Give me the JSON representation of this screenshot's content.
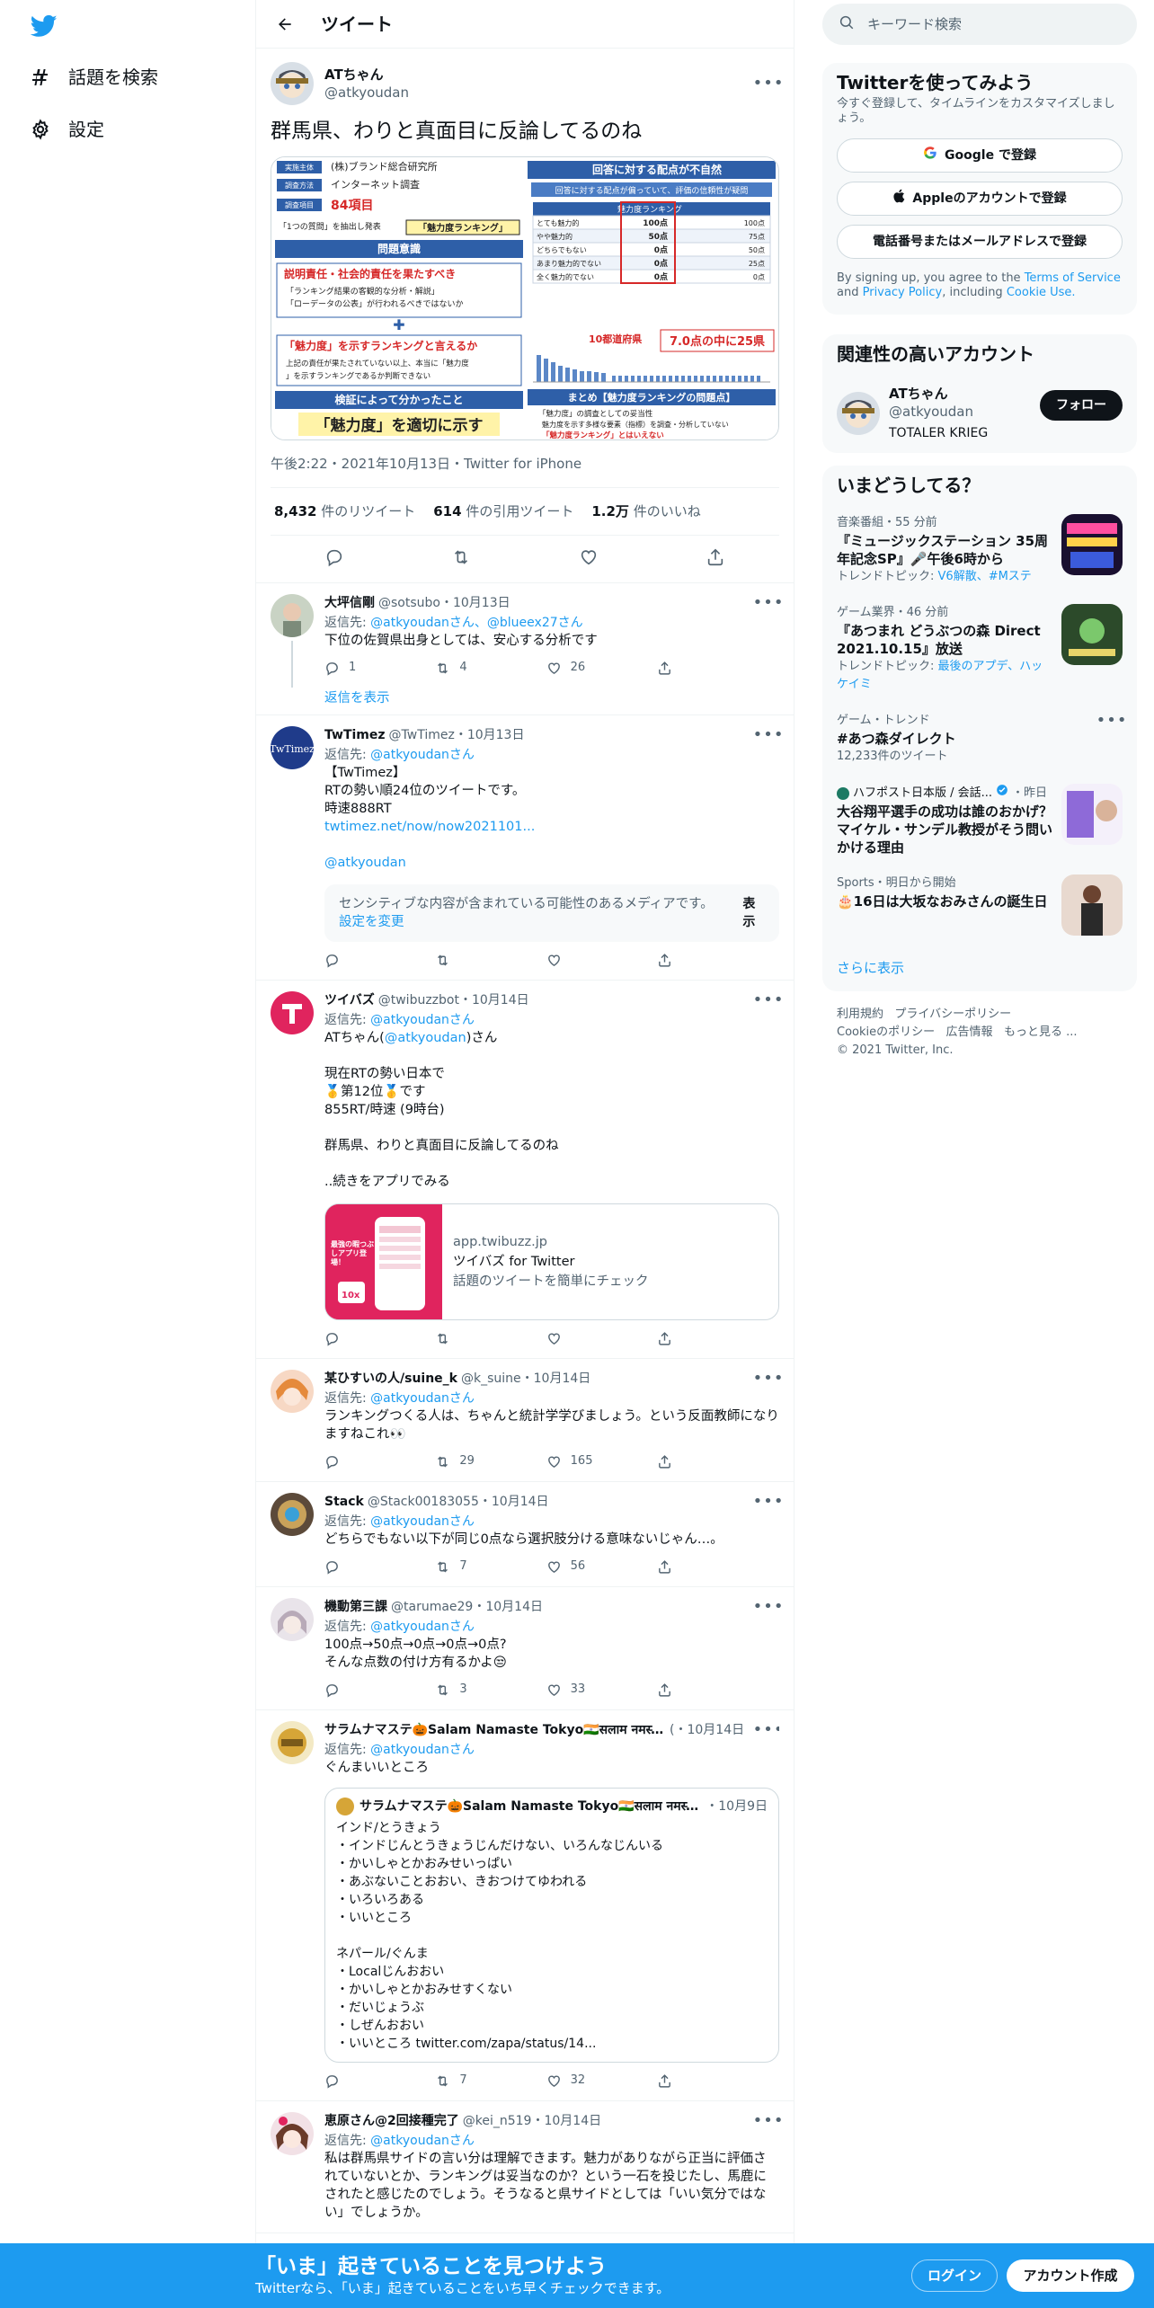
{
  "nav": {
    "explore_label": "話題を検索",
    "settings_label": "設定"
  },
  "header": {
    "title": "ツイート"
  },
  "focal": {
    "name": "ATちゃん",
    "handle": "@atkyoudan",
    "text": "群馬県、わりと真面目に反論してるのね",
    "timestamp": "午後2:22・2021年10月13日・Twitter for iPhone",
    "retweets_count": "8,432",
    "retweets_label": "件のリツイート",
    "quotes_count": "614",
    "quotes_label": "件の引用ツイート",
    "likes_count": "1.2万",
    "likes_label": "件のいいね",
    "photo_left": {
      "rows": [
        "(株)ブランド総合研究所",
        "インターネット調査",
        "84項目",
        "「1つの質問」を抽出し発表",
        "問題意識",
        "説明責任・社会的責任を果たすべき",
        "「ランキング結果の客観的な分析・解説」",
        "「ローデータの公表」が行われるべきではないか",
        "「魅力度」を示すランキングと言えるか",
        "上記の責任が果たされていない以上、本当に「魅力度」を示すランキングであるか判断できない",
        "検証によって分かったこと",
        "「魅力度」を適切に示す"
      ],
      "labels": [
        "実施主体",
        "調査方法",
        "調査項目",
        "「魅力度ランキング」"
      ]
    },
    "photo_right": {
      "title": "回答に対する配点が不自然",
      "subtitle": "回答に対する配点が偏っていて、評価の信頼性が疑問",
      "table_header": [
        "",
        "魅力度ランキング",
        ""
      ],
      "table_rows": [
        [
          "とても魅力的",
          "100点",
          "100点"
        ],
        [
          "やや魅力的",
          "50点",
          "75点"
        ],
        [
          "どちらでもない",
          "0点",
          "50点"
        ],
        [
          "あまり魅力的でない",
          "0点",
          "25点"
        ],
        [
          "全く魅力的でない",
          "0点",
          "0点"
        ]
      ],
      "chart_note1": "10都道府県",
      "chart_note2": "7.0点の中に25県",
      "summary_title": "まとめ【魅力度ランキングの問題点】",
      "summary_rows": [
        "「魅力度」の調査としての妥当性",
        "魅力度を示す多様な要素（指標）を調査・分析していない",
        "「魅力度ランキング」とはいえない"
      ]
    }
  },
  "replies": [
    {
      "name": "大坪信剛",
      "handle": "@sotsubo",
      "date": "10月13日",
      "reply_prefix": "返信先:",
      "reply_to": "@atkyoudanさん、@blueex27さん",
      "text": "下位の佐賀県出身としては、安心する分析です",
      "reply_count": "1",
      "retweet_count": "4",
      "like_count": "26",
      "show_replies": "返信を表示"
    },
    {
      "name": "TwTimez",
      "handle": "@TwTimez",
      "date": "10月13日",
      "reply_prefix": "返信先:",
      "reply_to": "@atkyoudanさん",
      "text_lines": [
        "【TwTimez】",
        "RTの勢い順24位のツイートです。",
        "時速888RT"
      ],
      "link": "twtimez.net/now/now2021101...",
      "mention": "@atkyoudan",
      "sensitive_text": "センシティブな内容が含まれている可能性のあるメディアです。",
      "sensitive_link": "設定を変更",
      "sensitive_button": "表示"
    },
    {
      "name": "ツイバズ",
      "handle": "@twibuzzbot",
      "date": "10月14日",
      "reply_prefix": "返信先:",
      "reply_to": "@atkyoudanさん",
      "text_before_mention": "ATちゃん(",
      "mention": "@atkyoudan",
      "text_after_mention": ")さん",
      "text_body": "現在RTの勢い日本で\n🥇第12位🥇です\n855RT/時速 (9時台)\n\n群馬県、わりと真面目に反論してるのね\n\n..続きをアプリでみる",
      "card_domain": "app.twibuzz.jp",
      "card_title": "ツイバズ for Twitter",
      "card_desc": "話題のツイートを簡単にチェック",
      "card_img_text": "最強の暇つぶしアプリ登場！",
      "card_badge": "10x"
    },
    {
      "name": "某ひすいの人/suine_k",
      "handle": "@k_suine",
      "date": "10月14日",
      "reply_prefix": "返信先:",
      "reply_to": "@atkyoudanさん",
      "text": "ランキングつくる人は、ちゃんと統計学学びましょう。という反面教師になりますねこれ👀",
      "reply_count": "",
      "retweet_count": "29",
      "like_count": "165"
    },
    {
      "name": "Stack",
      "handle": "@Stack00183055",
      "date": "10月14日",
      "reply_prefix": "返信先:",
      "reply_to": "@atkyoudanさん",
      "text": "どちらでもない以下が同じ0点なら選択肢分ける意味ないじゃん…。",
      "reply_count": "",
      "retweet_count": "7",
      "like_count": "56"
    },
    {
      "name": "機動第三課",
      "handle": "@tarumae29",
      "date": "10月14日",
      "reply_prefix": "返信先:",
      "reply_to": "@atkyoudanさん",
      "text": "100点→50点→0点→0点→0点?\nそんな点数の付け方有るかよ😒",
      "reply_count": "",
      "retweet_count": "3",
      "like_count": "33"
    },
    {
      "name": "サラムナマステ🎃Salam Namaste Tokyo🇮🇳सलाम नमस्ते🇳🇵",
      "handle": "(",
      "date": "10月14日",
      "reply_prefix": "返信先:",
      "reply_to": "@atkyoudanさん",
      "text": "ぐんまいいところ",
      "quote_name": "サラムナマステ🎃Salam Namaste Tokyo🇮🇳सलाम नमस्ते🇳🇵",
      "quote_date": "10月9日",
      "quote_text": "インド/とうきょう\n・インドじんとうきょうじんだけない、いろんなじんいる\n・かいしゃとかおみせいっぱい\n・あぶないことおおい、きおつけてゆわれる\n・いろいろある\n・いいところ\n\nネパール/ぐんま\n・Localじんおおい\n・かいしゃとかおみせすくない\n・だいじょうぶ\n・しぜんおおい\n・いいところ twitter.com/zapa/status/14...",
      "reply_count": "",
      "retweet_count": "7",
      "like_count": "32"
    },
    {
      "name": "恵原さん@2回接種完了",
      "handle": "@kei_n519",
      "date": "10月14日",
      "reply_prefix": "返信先:",
      "reply_to": "@atkyoudanさん",
      "text": "私は群馬県サイドの言い分は理解できます。魅力がありながら正当に評価されていないとか、ランキングは妥当なのか？という一石を投じたし、馬鹿にされたと感じたのでしょう。そうなると県サイドとしては「いい気分ではない」でしょうか。"
    }
  ],
  "right": {
    "search_placeholder": "キーワード検索",
    "signup_title": "Twitterを使ってみよう",
    "signup_desc": "今すぐ登録して、タイムラインをカスタマイズしましょう。",
    "google_btn": "Google で登録",
    "apple_btn": "Appleのアカウントで登録",
    "phone_btn": "電話番号またはメールアドレスで登録",
    "legal_prefix": "By signing up, you agree to the",
    "terms": "Terms of Service",
    "and": "and",
    "privacy": "Privacy Policy",
    "including": ", including",
    "cookie": "Cookie Use.",
    "related_title": "関連性の高いアカウント",
    "related_name": "ATちゃん",
    "related_handle": "@atkyoudan",
    "related_bio": "TOTALER KRIEG",
    "follow_btn": "フォロー",
    "trends_title": "いまどうしてる？",
    "trends": [
      {
        "ctx": "音楽番組・55 分前",
        "title": "『ミュージックステーション 35周年記念SP』🎤午後6時から",
        "sub_prefix": "トレンドトピック:",
        "sub_links": "V6解散、#Mステ"
      },
      {
        "ctx": "ゲーム業界・46 分前",
        "title": "『あつまれ どうぶつの森 Direct 2021.10.15』放送",
        "sub_prefix": "トレンドトピック:",
        "sub_links": "最後のアプデ、ハッケイミ"
      },
      {
        "ctx": "ゲーム・トレンド",
        "title": "#あつ森ダイレクト",
        "count": "12,233件のツイート"
      },
      {
        "ctx_name": "ハフポスト日本版 / 会話...",
        "ctx_time": "・昨日",
        "title": "大谷翔平選手の成功は誰のおかげ？ マイケル・サンデル教授がそう問いかける理由"
      },
      {
        "ctx": "Sports・明日から開始",
        "title": "🎂16日は大坂なおみさんの誕生日"
      }
    ],
    "show_more": "さらに表示",
    "footer": [
      "利用規約",
      "プライバシーポリシー",
      "Cookieのポリシー",
      "広告情報",
      "もっと見る ...",
      "© 2021 Twitter, Inc."
    ]
  },
  "bottom": {
    "headline": "「いま」起きていることを見つけよう",
    "sub": "Twitterなら、「いま」起きていることをいち早くチェックできます。",
    "login": "ログイン",
    "signup": "アカウント作成"
  },
  "colors": {
    "accent": "#1d9bf0",
    "text": "#0f1419",
    "muted": "#536471"
  }
}
